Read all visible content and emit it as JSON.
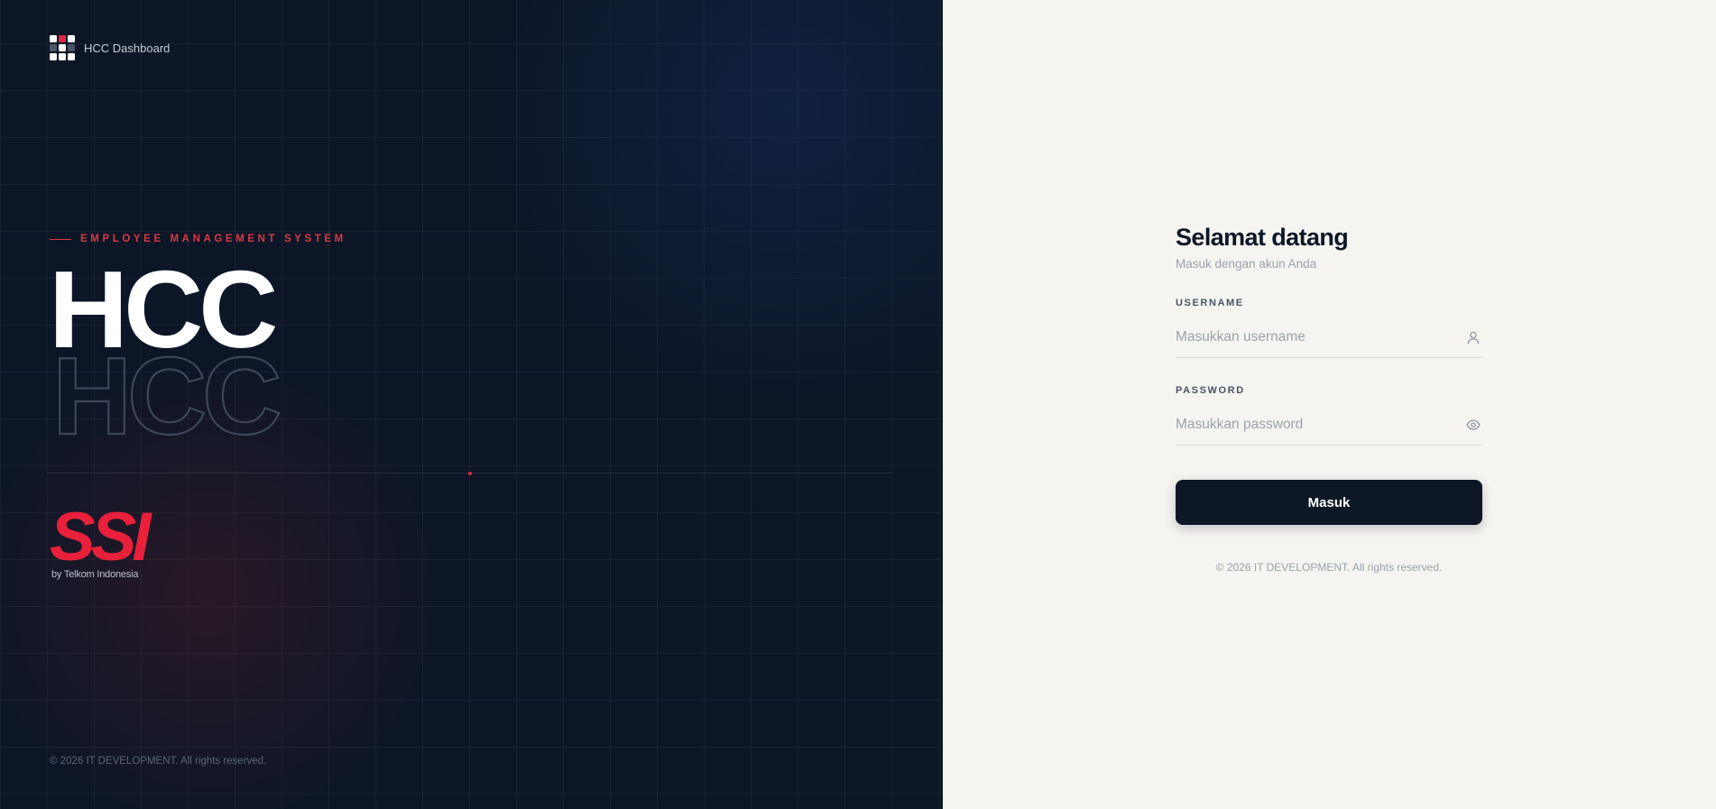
{
  "brand": {
    "name": "HCC Dashboard"
  },
  "hero": {
    "eyebrow": "EMPLOYEE MANAGEMENT SYSTEM",
    "wordmark": "HCC",
    "wordmark_outline": "HCC"
  },
  "partner": {
    "logo_text": "SSI",
    "tagline": "by Telkom Indonesia"
  },
  "left_footer": {
    "copyright": "© 2026 IT DEVELOPMENT. All rights reserved."
  },
  "login": {
    "title": "Selamat datang",
    "subtitle": "Masuk dengan akun Anda",
    "username": {
      "label": "USERNAME",
      "placeholder": "Masukkan username",
      "value": "",
      "icon": "user-icon"
    },
    "password": {
      "label": "PASSWORD",
      "placeholder": "Masukkan password",
      "value": "",
      "icon": "eye-icon"
    },
    "submit_label": "Masuk",
    "copyright": "© 2026 IT DEVELOPMENT. All rights reserved."
  },
  "colors": {
    "left_bg": "#0c1627",
    "right_bg": "#f5f4f1",
    "accent_red": "#e8203a",
    "button_bg": "#0e1726"
  }
}
